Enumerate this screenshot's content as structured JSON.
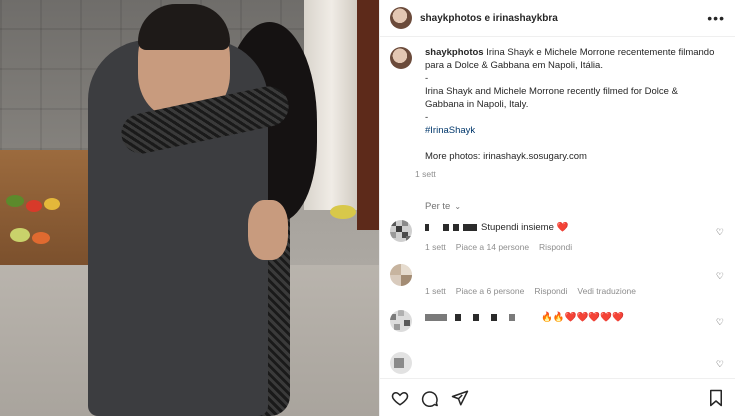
{
  "post": {
    "header_name": "shaykphotos e irinashaykbra",
    "caption": {
      "username": "shaykphotos",
      "line_pt": "Irina Shayk e Michele Morrone recentemente filmando para a Dolce & Gabbana em Napoli, Itália.",
      "sep1": "-",
      "line_en": "Irina Shayk and Michele Morrone recently filmed for Dolce & Gabbana in Napoli, Italy.",
      "sep2": "-",
      "hashtag": "#IrinaShayk",
      "more": "More photos: irinashayk.sosugary.com",
      "time": "1 sett"
    },
    "for_you": "Per te",
    "comments": [
      {
        "text": "Stupendi insieme ❤️",
        "time": "1 sett",
        "likes": "Piace a 14 persone",
        "reply": "Rispondi",
        "translate": ""
      },
      {
        "text": "",
        "time": "1 sett",
        "likes": "Piace a 6 persone",
        "reply": "Rispondi",
        "translate": "Vedi traduzione"
      },
      {
        "text": "🔥🔥❤️❤️❤️❤️❤️",
        "time": "",
        "likes": "",
        "reply": "",
        "translate": ""
      }
    ]
  },
  "icons": {
    "more": "more-icon",
    "like": "heart-icon",
    "comment": "comment-icon",
    "share": "send-icon",
    "save": "bookmark-icon"
  },
  "colors": {
    "text": "#262626",
    "muted": "#8e8e8e",
    "hashtag": "#00376b"
  }
}
